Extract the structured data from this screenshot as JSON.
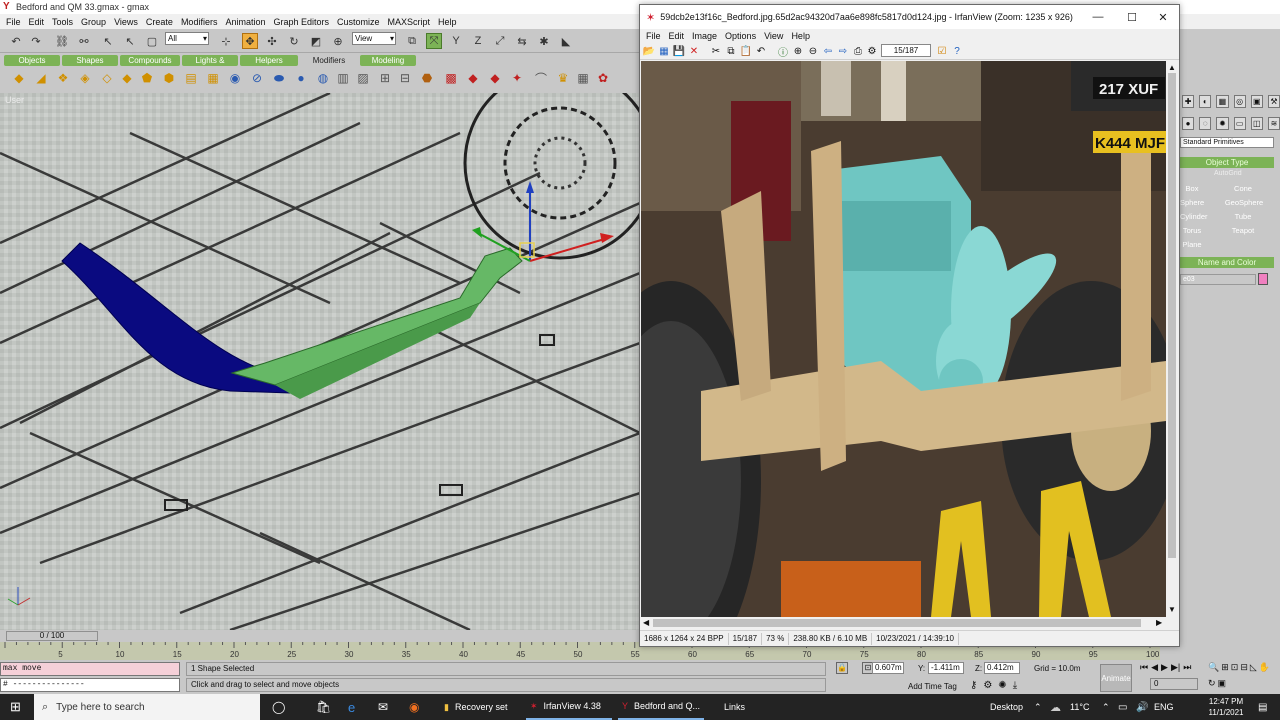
{
  "gmax": {
    "title": "Bedford and QM 33.gmax - gmax",
    "menu": [
      "File",
      "Edit",
      "Tools",
      "Group",
      "Views",
      "Create",
      "Modifiers",
      "Animation",
      "Graph Editors",
      "Customize",
      "MAXScript",
      "Help"
    ],
    "selection_filter": "All",
    "reference_coord": "View",
    "tabs": [
      "Objects",
      "Shapes",
      "Compounds",
      "Lights & Cameras",
      "Helpers",
      "Modifiers",
      "Modeling"
    ],
    "selected_tab": "Modifiers",
    "viewport_label": "User",
    "command_panel": {
      "category": "Standard Primitives",
      "object_type_header": "Object Type",
      "autogrid": "AutoGrid",
      "buttons": [
        "Box",
        "Cone",
        "Sphere",
        "GeoSphere",
        "Cylinder",
        "Tube",
        "Torus",
        "Teapot",
        "Plane"
      ],
      "name_color_header": "Name and Color",
      "name_value": "e03",
      "swatch_color": "#f080c0"
    },
    "time_slider": "0 / 100",
    "track_ticks": [
      "5",
      "10",
      "15",
      "20",
      "25",
      "30",
      "35",
      "40",
      "45",
      "50",
      "55",
      "60",
      "65",
      "70",
      "75",
      "80",
      "85",
      "90",
      "95",
      "100"
    ],
    "maxscript_top": "max move",
    "maxscript_bottom": "# ---------------",
    "status_selected": "1 Shape Selected",
    "status_prompt": "Click and drag to select and move objects",
    "coords": {
      "x_label": "X:",
      "x": "0.607m",
      "y_label": "Y:",
      "y": "-1.411m",
      "z_label": "Z:",
      "z": "0.412m"
    },
    "grid": "Grid = 10.0m",
    "add_time_tag": "Add Time Tag",
    "animate": "Animate",
    "frame_value": "0"
  },
  "irfanview": {
    "title": "59dcb2e13f16c_Bedford.jpg.65d2ac94320d7aa6e898fc5817d0d124.jpg - IrfanView (Zoom: 1235 x 926)",
    "menu": [
      "File",
      "Edit",
      "Image",
      "Options",
      "View",
      "Help"
    ],
    "page_counter": "15/187",
    "image_plate": "217 XUF",
    "image_plate2": "K444 MJF",
    "status": [
      "1686 x 1264 x 24 BPP",
      "15/187",
      "73 %",
      "238.80 KB / 6.10 MB",
      "10/23/2021 / 14:39:10"
    ],
    "accent": "#d02030"
  },
  "taskbar": {
    "search_placeholder": "Type here to search",
    "apps": [
      {
        "label": "Recovery set"
      },
      {
        "label": "IrfanView 4.38"
      },
      {
        "label": "Bedford and Q..."
      }
    ],
    "links": "Links",
    "desktop": "Desktop",
    "weather": "11°C",
    "language": "ENG",
    "time": "12:47 PM",
    "date": "11/1/2021"
  }
}
